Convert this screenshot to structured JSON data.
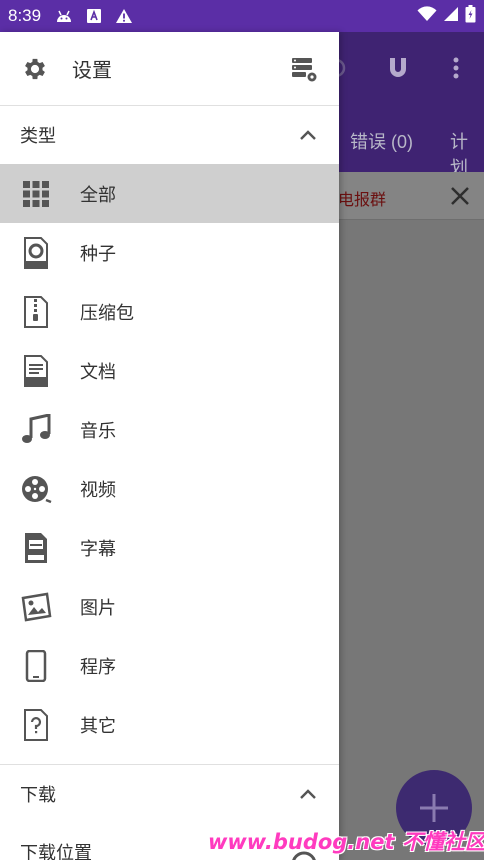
{
  "status_bar": {
    "time": "8:39",
    "icons": [
      "android-debug-icon",
      "a-badge-icon",
      "warning-icon"
    ],
    "right_icons": [
      "wifi-icon",
      "signal-icon",
      "battery-icon"
    ]
  },
  "background": {
    "tabs": [
      {
        "label": "错误 (0)"
      },
      {
        "label": "计划"
      }
    ],
    "notice": "电报群",
    "toolbar_color": "#3f2372"
  },
  "drawer": {
    "header": {
      "title": "设置"
    },
    "category_section": {
      "label": "类型"
    },
    "items": [
      {
        "label": "全部",
        "icon": "grid-icon",
        "selected": true
      },
      {
        "label": "种子",
        "icon": "torrent-file-icon"
      },
      {
        "label": "压缩包",
        "icon": "zip-file-icon"
      },
      {
        "label": "文档",
        "icon": "doc-file-icon"
      },
      {
        "label": "音乐",
        "icon": "music-note-icon"
      },
      {
        "label": "视频",
        "icon": "film-reel-icon"
      },
      {
        "label": "字幕",
        "icon": "subtitle-file-icon"
      },
      {
        "label": "图片",
        "icon": "image-icon"
      },
      {
        "label": "程序",
        "icon": "phone-icon"
      },
      {
        "label": "其它",
        "icon": "unknown-file-icon"
      }
    ],
    "download_section": {
      "label": "下载"
    },
    "download_location": {
      "label": "下载位置"
    }
  },
  "watermark": "www.budog.net 不懂社区",
  "colors": {
    "accent": "#5b2ea6",
    "selected_bg": "#cfcfcf"
  }
}
